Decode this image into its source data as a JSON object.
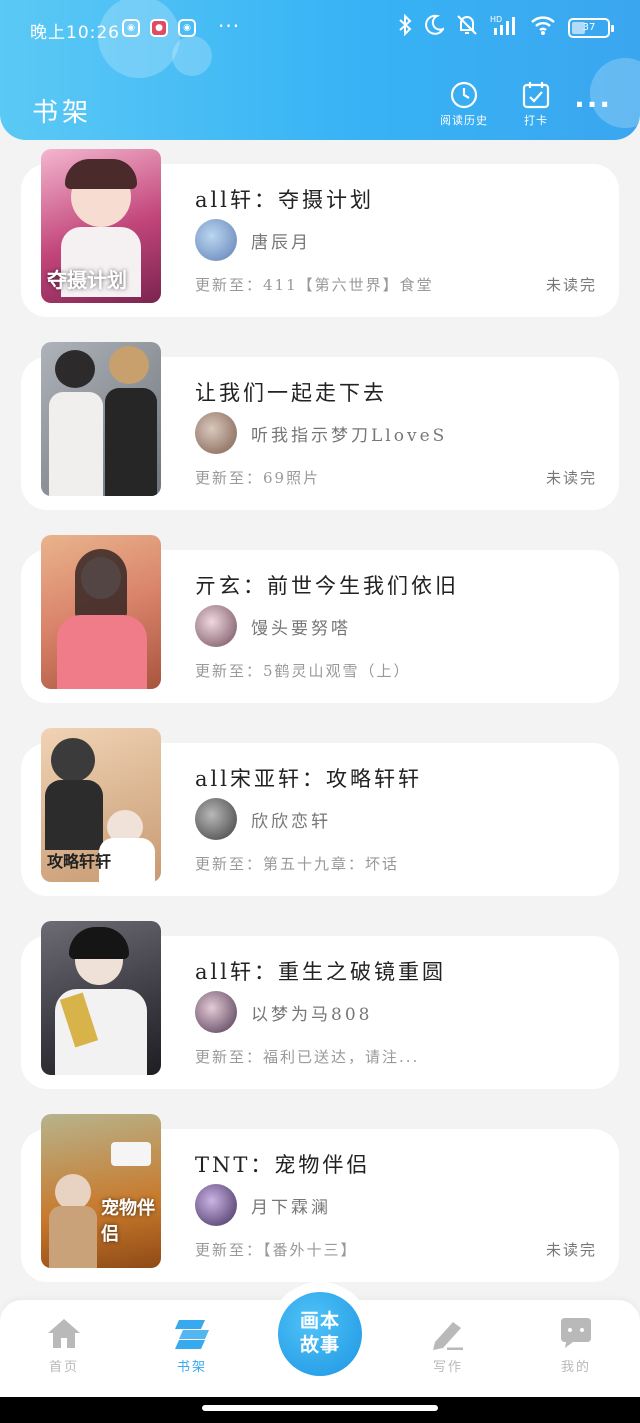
{
  "status_bar": {
    "time": "晚上10:26",
    "dots": "···",
    "battery": "37",
    "icons": [
      "bluetooth-icon",
      "moon-icon",
      "mute-bell-icon",
      "signal-icon",
      "wifi-icon",
      "battery-icon"
    ]
  },
  "header": {
    "title": "书架",
    "history_label": "阅读历史",
    "checkin_label": "打卡",
    "more": "···"
  },
  "books": [
    {
      "title": "all轩：夺摄计划",
      "author": "唐辰月",
      "update": "更新至：411【第六世界】食堂",
      "status": "未读完",
      "cover_text": "夺摄计划",
      "cover_color": "#c2457a"
    },
    {
      "title": "让我们一起走下去",
      "author": "听我指示梦刀LloveS",
      "update": "更新至：69照片",
      "status": "未读完",
      "cover_text": "",
      "cover_color": "#8a8f96"
    },
    {
      "title": "亓玄：前世今生我们依旧",
      "author": "馒头要努嗒",
      "update": "更新至：5鹤灵山观雪（上）",
      "status": "",
      "cover_text": "",
      "cover_color": "#d9826a"
    },
    {
      "title": "all宋亚轩：攻略轩轩",
      "author": "欣欣恋轩",
      "update": "更新至：第五十九章：坏话",
      "status": "",
      "cover_text": "攻略轩轩",
      "cover_color": "#c79a72"
    },
    {
      "title": "all轩：重生之破镜重圆",
      "author": "以梦为马808",
      "update": "更新至：福利已送达，请注...",
      "status": "",
      "cover_text": "",
      "cover_color": "#3b3a42"
    },
    {
      "title": "TNT：宠物伴侣",
      "author": "月下霖澜",
      "update": "更新至：【番外十三】",
      "status": "未读完",
      "cover_text": "宠物伴侣",
      "cover_color": "#c87a2c"
    }
  ],
  "bottom_nav": {
    "home": "首页",
    "shelf": "书架",
    "fab_line1": "画本",
    "fab_line2": "故事",
    "write": "写作",
    "me": "我的"
  },
  "colors": {
    "accent": "#36a9ef",
    "header_start": "#5bc9f5",
    "header_end": "#3aa6ef"
  }
}
